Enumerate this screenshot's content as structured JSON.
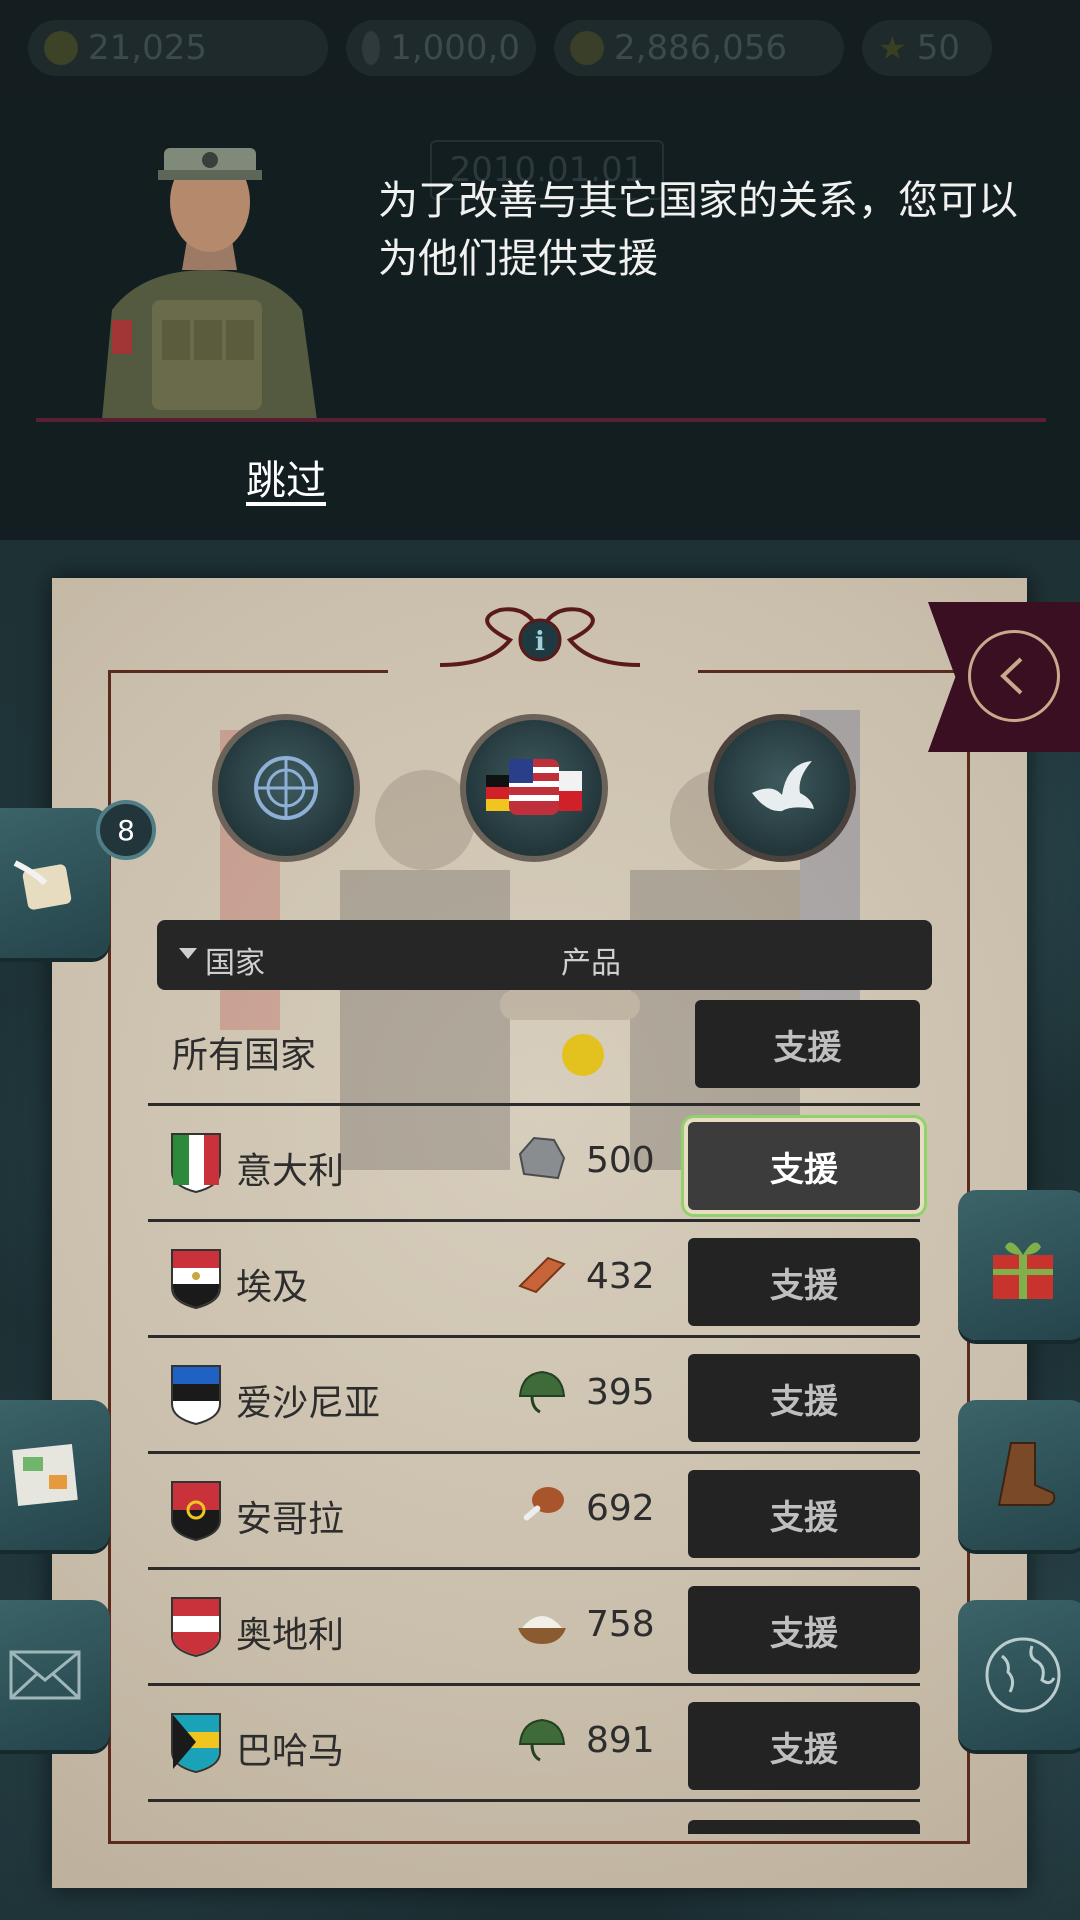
{
  "topbar": {
    "gold": "21,025",
    "diamonds": "1,000,0",
    "population": "2,886,056",
    "stars": "50",
    "date": "2010.01.01"
  },
  "tutorial": {
    "message": "为了改善与其它国家的关系，您可以为他们提供支援",
    "skip_label": "跳过"
  },
  "panel": {
    "info_icon": "info-icon",
    "tabs": [
      "un-emblem-icon",
      "allies-flags-icon",
      "dove-peace-icon"
    ],
    "table": {
      "col_country": "国家",
      "col_product": "产品",
      "all_countries": "所有国家",
      "support_label": "支援",
      "rows": [
        {
          "country": "意大利",
          "product": "stone-icon",
          "qty": "500",
          "flag": [
            "#2d8a3a",
            "#ffffff",
            "#c9323a"
          ]
        },
        {
          "country": "埃及",
          "product": "brick-icon",
          "qty": "432",
          "flag": [
            "#c9323a",
            "#ffffff",
            "#1a1a1a"
          ]
        },
        {
          "country": "爱沙尼亚",
          "product": "helmet-icon",
          "qty": "395",
          "flag": [
            "#1f62c4",
            "#1a1a1a",
            "#ffffff"
          ]
        },
        {
          "country": "安哥拉",
          "product": "meat-icon",
          "qty": "692",
          "flag": [
            "#c9323a",
            "#1a1a1a",
            "#1a1a1a"
          ]
        },
        {
          "country": "奥地利",
          "product": "flour-icon",
          "qty": "758",
          "flag": [
            "#c9323a",
            "#ffffff",
            "#c9323a"
          ]
        },
        {
          "country": "巴哈马",
          "product": "helmet-icon",
          "qty": "891",
          "flag": [
            "#1aa3b8",
            "#f0c530",
            "#1aa3b8"
          ]
        }
      ]
    }
  },
  "side": {
    "notes_badge": "8"
  },
  "colors": {
    "highlight": "#8fd36a",
    "ribbon": "#3a0f22",
    "coin": "#e3c11f"
  }
}
